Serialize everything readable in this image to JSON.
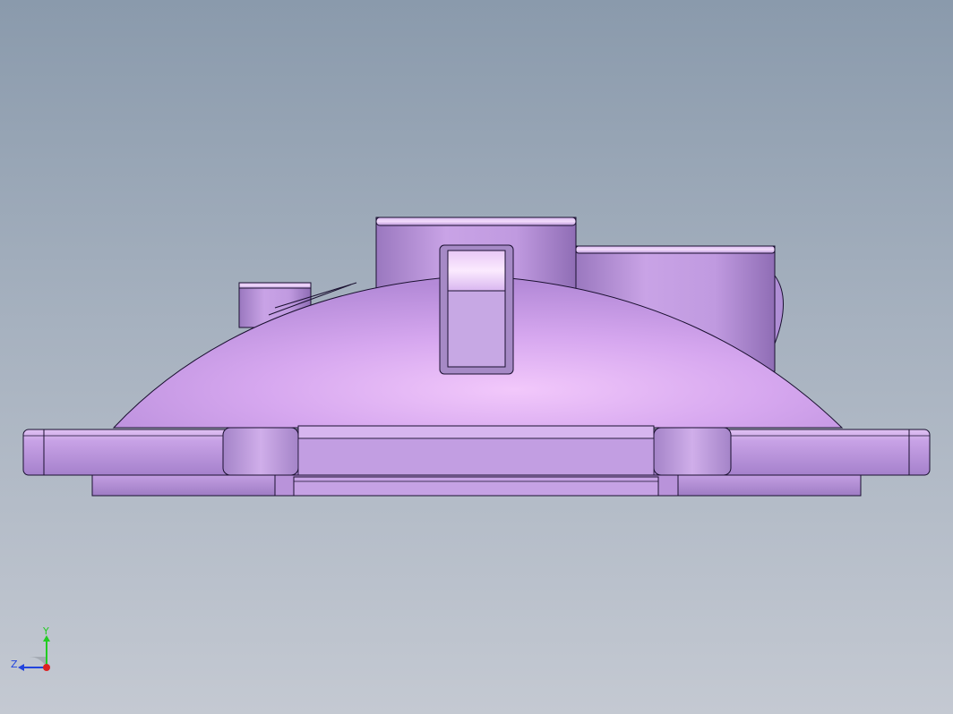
{
  "viewport": {
    "background_top": "#8a9aac",
    "background_bottom": "#c4c9d2"
  },
  "model": {
    "color": "#c9a0e6",
    "edge_color": "#1a1030"
  },
  "triad": {
    "y_label": "Y",
    "z_label": "Z",
    "y_color": "#22cc22",
    "z_color": "#2244dd",
    "x_color": "#dd2222"
  }
}
